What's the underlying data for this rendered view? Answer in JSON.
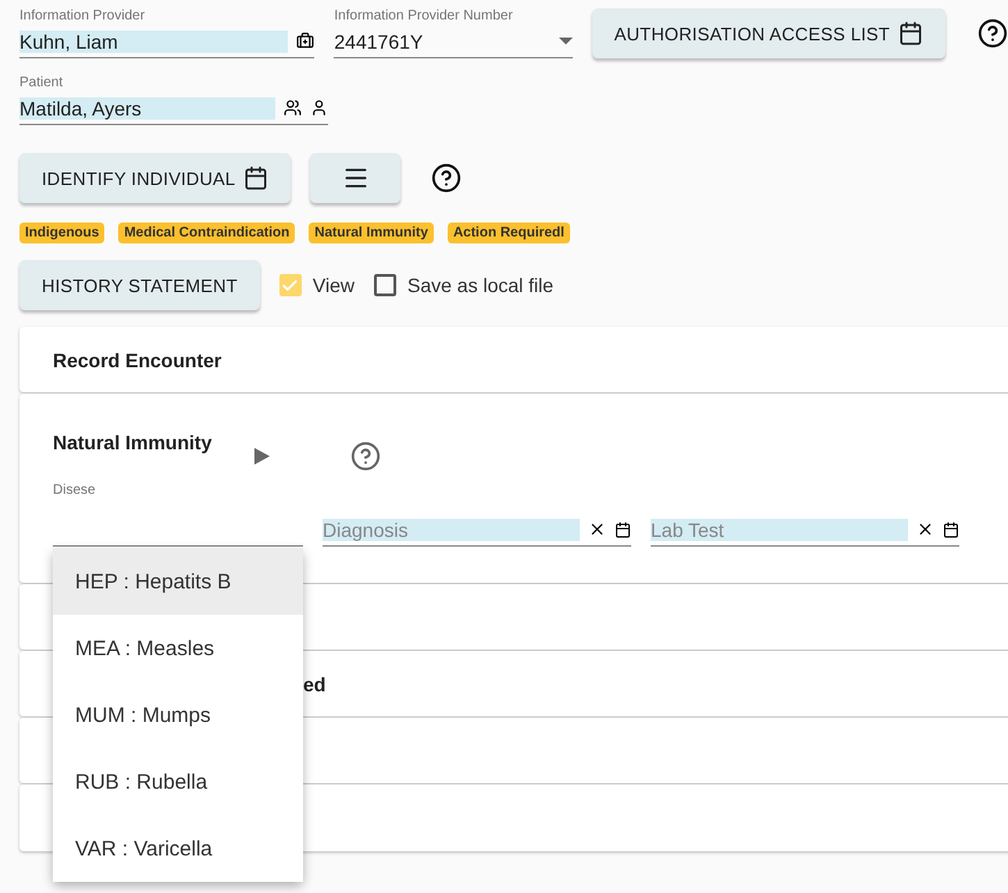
{
  "provider": {
    "label": "Information Provider",
    "value": "Kuhn, Liam"
  },
  "provider_number": {
    "label": "Information Provider Number",
    "value": "2441761Y"
  },
  "authorisation_button": "AUTHORISATION ACCESS LIST",
  "patient": {
    "label": "Patient",
    "value": "Matilda, Ayers"
  },
  "identify_button": "IDENTIFY INDIVIDUAL",
  "tags": [
    "Indigenous",
    "Medical Contraindication",
    "Natural Immunity",
    "Action Requiredl"
  ],
  "history_button": "HISTORY STATEMENT",
  "options": [
    {
      "label": "View",
      "checked": true
    },
    {
      "label": "Save as local file",
      "checked": false
    }
  ],
  "panels": [
    {
      "kind": "header",
      "title": "Record Encounter"
    },
    {
      "kind": "form",
      "title": "Natural Immunity",
      "disease_label": "Disese",
      "diagnosis_placeholder": "Diagnosis",
      "lab_test_placeholder": "Lab Test"
    },
    {
      "kind": "collapsed"
    },
    {
      "kind": "collapsed",
      "title_tail": "ed"
    },
    {
      "kind": "collapsed"
    },
    {
      "kind": "collapsed"
    }
  ],
  "disease_menu": [
    {
      "label": "HEP : Hepatits B",
      "selected": true
    },
    {
      "label": "MEA : Measles",
      "selected": false
    },
    {
      "label": "MUM : Mumps",
      "selected": false
    },
    {
      "label": "RUB : Rubella",
      "selected": false
    },
    {
      "label": "VAR : Varicella",
      "selected": false
    }
  ]
}
